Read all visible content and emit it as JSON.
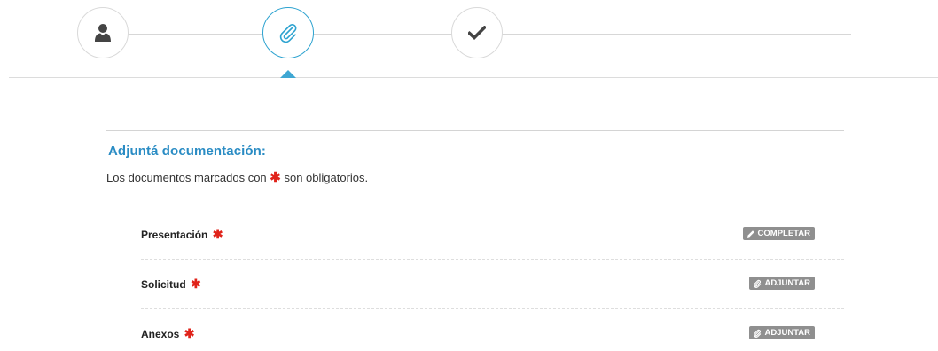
{
  "stepper": {
    "steps": [
      {
        "icon": "user-icon",
        "state": "done"
      },
      {
        "icon": "paperclip-icon",
        "state": "active"
      },
      {
        "icon": "checkmark-icon",
        "state": "pending"
      }
    ]
  },
  "section": {
    "title": "Adjuntá documentación:",
    "note_before": "Los documentos marcados con",
    "required_mark": "✱",
    "note_after": "son obligatorios."
  },
  "documents": [
    {
      "name": "Presentación",
      "required_mark": "✱",
      "action_label": "COMPLETAR",
      "action_icon": "pencil-icon"
    },
    {
      "name": "Solicitud",
      "required_mark": "✱",
      "action_label": "ADJUNTAR",
      "action_icon": "paperclip-icon"
    },
    {
      "name": "Anexos",
      "required_mark": "✱",
      "action_label": "ADJUNTAR",
      "action_icon": "paperclip-icon"
    }
  ],
  "colors": {
    "accent": "#2a8cc4",
    "required": "#e0231a",
    "button": "#8f8f8f"
  }
}
